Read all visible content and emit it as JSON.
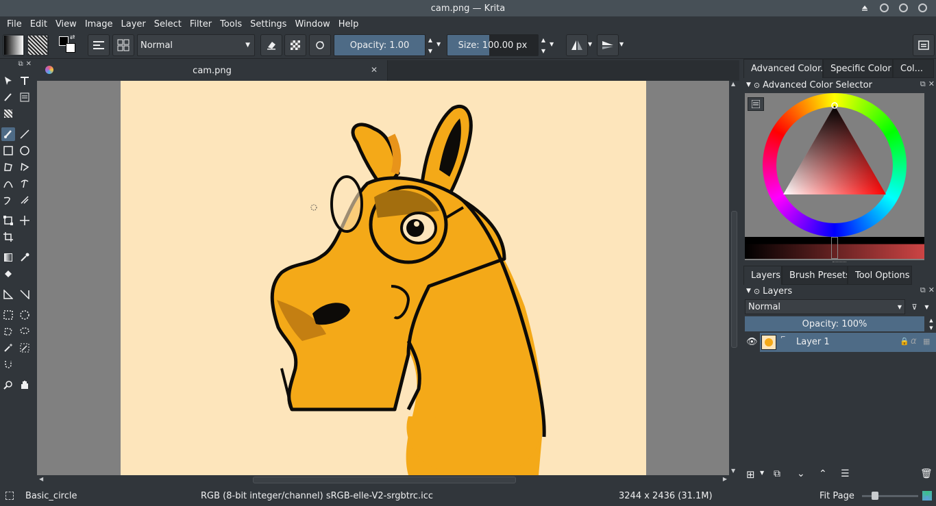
{
  "window": {
    "title": "cam.png  — Krita"
  },
  "menu": [
    "File",
    "Edit",
    "View",
    "Image",
    "Layer",
    "Select",
    "Filter",
    "Tools",
    "Settings",
    "Window",
    "Help"
  ],
  "toolbar": {
    "blend_mode": "Normal",
    "opacity_label": "Opacity:  1.00",
    "opacity_value": 1.0,
    "size_label": "Size:  100.00 px",
    "size_value": 100.0
  },
  "document": {
    "tab_name": "cam.png"
  },
  "right_panel": {
    "tabs": [
      "Advanced Color...",
      "Specific Color ...",
      "Col..."
    ],
    "color_selector_title": "Advanced Color Selector",
    "lower_tabs": [
      "Layers",
      "Brush Presets",
      "Tool Options"
    ],
    "layers_title": "Layers",
    "layers_blend": "Normal",
    "layers_opacity": "Opacity:  100%",
    "layer_name": "Layer 1"
  },
  "status": {
    "brush": "Basic_circle",
    "color_model": "RGB (8-bit integer/channel)  sRGB-elle-V2-srgbtrc.icc",
    "dimensions": "3244 x 2436 (31.1M)",
    "zoom": "Fit Page"
  },
  "colors": {
    "accent": "#4e6b86",
    "canvas_bg": "#fde5bb",
    "camel": "#f4a918",
    "outline": "#0d0b08"
  }
}
